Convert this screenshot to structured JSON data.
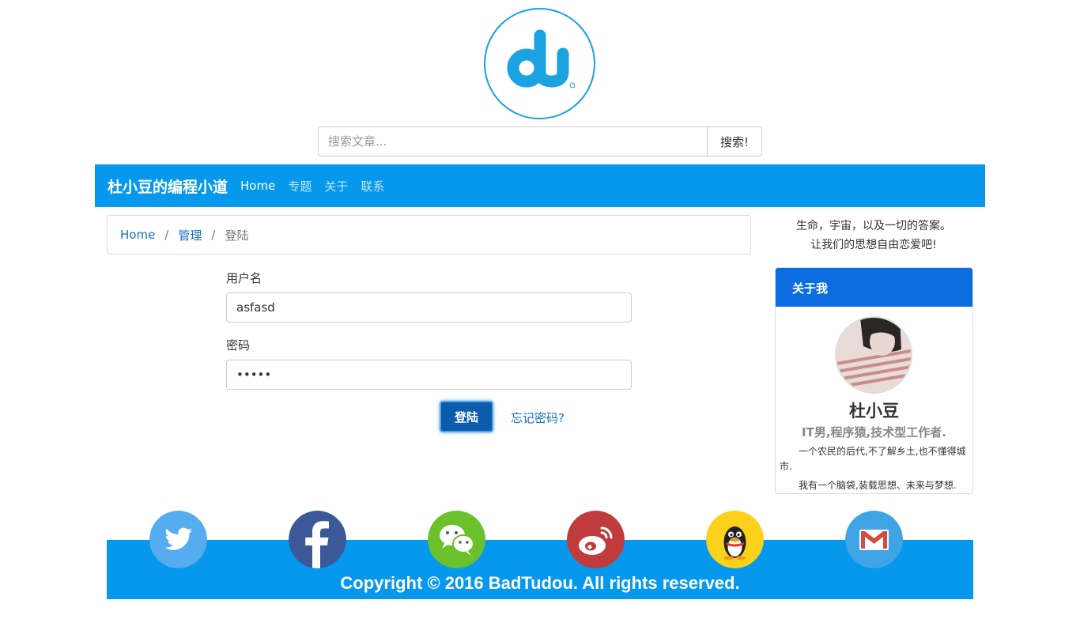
{
  "logo": {
    "icon": "du-logo-icon",
    "color": "#1a9ee6"
  },
  "search": {
    "placeholder": "搜索文章...",
    "button_label": "搜索!"
  },
  "navbar": {
    "brand": "杜小豆的编程小道",
    "items": [
      {
        "label": "Home",
        "active": true
      },
      {
        "label": "专题",
        "active": false
      },
      {
        "label": "关于",
        "active": false
      },
      {
        "label": "联系",
        "active": false
      }
    ],
    "color": "#0698ec"
  },
  "breadcrumb": {
    "items": [
      "Home",
      "管理"
    ],
    "current": "登陆",
    "separator": "/"
  },
  "login_form": {
    "username_label": "用户名",
    "username_value": "asfasd",
    "password_label": "密码",
    "password_value": "•••••",
    "submit_label": "登陆",
    "forgot_label": "忘记密码?"
  },
  "sidebar": {
    "motto_line1": "生命，宇宙，以及一切的答案。",
    "motto_line2": "让我们的思想自由恋爱吧!",
    "about": {
      "heading": "关于我",
      "name": "杜小豆",
      "title": "IT男,程序猿,技术型工作者.",
      "desc1": "一个农民的后代,不了解乡土,也不懂得城市.",
      "desc2": "我有一个脑袋,装载思想、未来与梦想."
    }
  },
  "footer": {
    "copyright": "Copyright © 2016 BadTudou. All rights reserved.",
    "social": [
      "twitter-icon",
      "facebook-icon",
      "wechat-icon",
      "weibo-icon",
      "qq-icon",
      "gmail-icon"
    ]
  }
}
